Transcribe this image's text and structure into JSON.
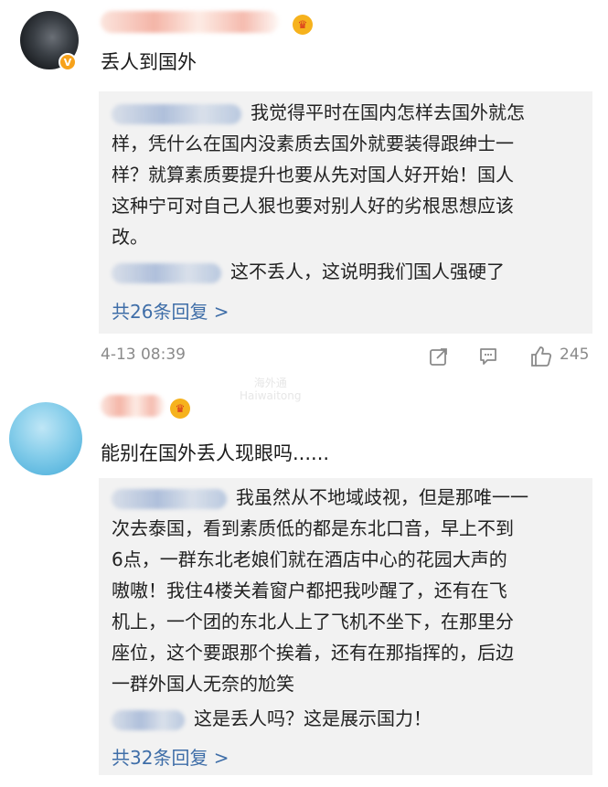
{
  "comments": [
    {
      "text": "丢人到国外",
      "replies": [
        "我觉得平时在国内怎样去国外就怎",
        "样，凭什么在国内没素质去国外就要装得跟绅士一",
        "样？就算素质要提升也要从先对国人好开始！国人",
        "这种宁可对自己人狠也要对别人好的劣根思想应该",
        "改。"
      ],
      "reply2": "这不丢人，这说明我们国人强硬了",
      "more": "共26条回复 >",
      "time": "4-13 08:39",
      "likes": "245"
    },
    {
      "text": "能别在国外丢人现眼吗......",
      "replies": [
        "我虽然从不地域歧视，但是那唯一一",
        "次去泰国，看到素质低的都是东北口音，早上不到",
        "6点，一群东北老娘们就在酒店中心的花园大声的",
        "嗷嗷！我住4楼关着窗户都把我吵醒了，还有在飞",
        "机上，一个团的东北人上了飞机不坐下，在那里分",
        "座位，这个要跟那个挨着，还有在那指挥的，后边",
        "一群外国人无奈的尬笑"
      ],
      "reply2": "这是丢人吗？这是展示国力！",
      "more": "共32条回复 >"
    }
  ],
  "watermark": {
    "line1": "海外通",
    "line2": "Haiwaitong"
  },
  "icons": [
    "share-icon",
    "comment-icon",
    "like-icon"
  ]
}
